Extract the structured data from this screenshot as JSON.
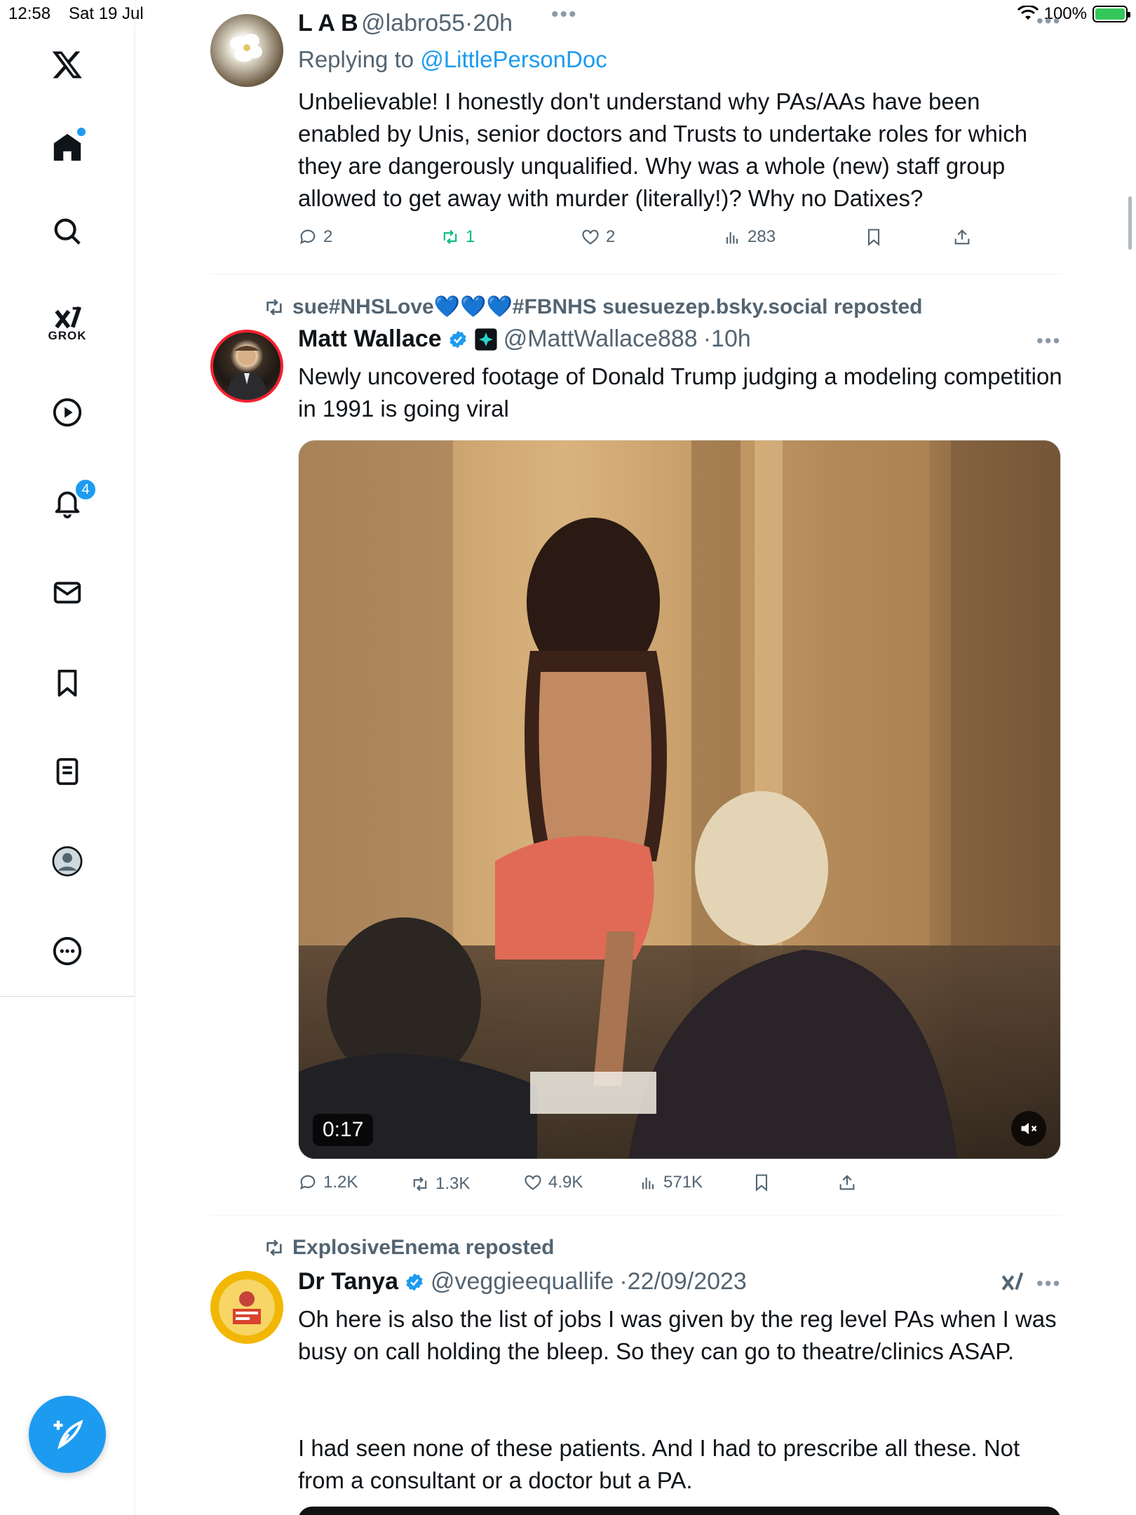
{
  "status_bar": {
    "time": "12:58",
    "date": "Sat 19 Jul",
    "battery": "100%"
  },
  "sidebar": {
    "items": [
      {
        "name": "x-logo",
        "label": ""
      },
      {
        "name": "home",
        "label": ""
      },
      {
        "name": "search",
        "label": ""
      },
      {
        "name": "grok",
        "label": "GROK"
      },
      {
        "name": "video",
        "label": ""
      },
      {
        "name": "notifications",
        "label": "",
        "badge": "4"
      },
      {
        "name": "messages",
        "label": ""
      },
      {
        "name": "bookmarks",
        "label": ""
      },
      {
        "name": "lists",
        "label": ""
      },
      {
        "name": "profile",
        "label": ""
      },
      {
        "name": "more",
        "label": ""
      }
    ]
  },
  "feed": {
    "post1": {
      "name": "L A B",
      "handle": "@labro55",
      "time": "·20h",
      "replying_prefix": "Replying to ",
      "replying_to": "@LittlePersonDoc",
      "text": "Unbelievable! I honestly don't understand why PAs/AAs have been enabled by Unis, senior doctors and Trusts to undertake roles for which they are dangerously unqualified. Why was a whole (new) staff group allowed to get away with murder (literally!)? Why no Datixes?",
      "replies": "2",
      "reposts": "1",
      "likes": "2",
      "views": "283"
    },
    "post2": {
      "reposted_by": "sue#NHSLove💙💙💙#FBNHS suesuezep.bsky.social reposted",
      "name": "Matt Wallace",
      "handle": "@MattWallace888",
      "time": "·10h",
      "text": "Newly uncovered footage of Donald Trump judging a modeling competition in 1991 is going viral",
      "video_duration": "0:17",
      "replies": "1.2K",
      "reposts": "1.3K",
      "likes": "4.9K",
      "views": "571K"
    },
    "post3": {
      "reposted_by": "ExplosiveEnema reposted",
      "name": "Dr Tanya",
      "handle": "@veggieequallife",
      "time": "·22/09/2023",
      "text_line1": "Oh here is also the list of jobs I was given by the reg level PAs when I was busy on call holding the bleep. So they can go to theatre/clinics ASAP.",
      "text_line2": "I had seen none of these patients. And I had to prescribe all these. Not from a consultant or a doctor but a PA."
    }
  },
  "colors": {
    "accent": "#1d9bf0",
    "repost_green": "#00ba7c",
    "secondary_text": "#536471"
  }
}
